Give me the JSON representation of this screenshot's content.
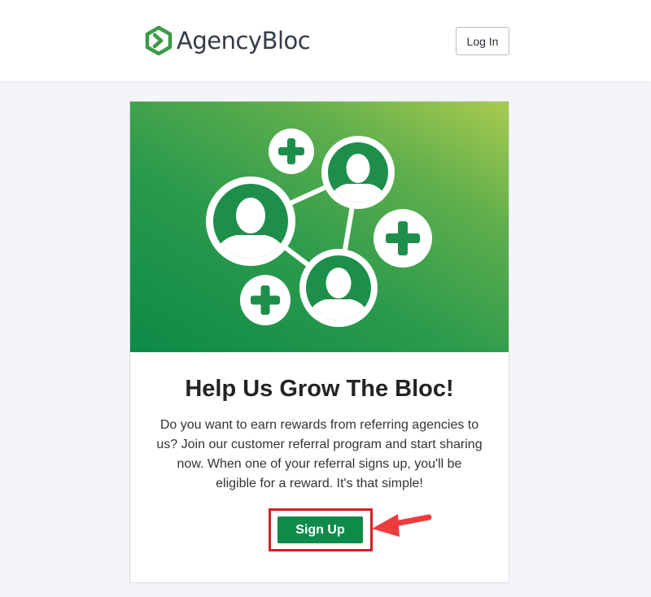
{
  "header": {
    "brand_name": "AgencyBloc",
    "login_label": "Log In"
  },
  "promo": {
    "title": "Help Us Grow The Bloc!",
    "body": "Do you want to earn rewards from referring agencies to us? Join our customer referral program and start sharing now. When one of your referral signs up, you'll be eligible for a reward. It's that simple!",
    "signup_label": "Sign Up"
  },
  "icons": {
    "logo": "agencybloc-hexagon-icon",
    "hero": "referral-network-icon",
    "plus": "plus-icon",
    "person": "person-icon",
    "annotation": "red-arrow-icon"
  },
  "colors": {
    "brand_green": "#0e8a49",
    "logo_green": "#3a9b46",
    "highlight_red": "#d51f26",
    "page_bg": "#f4f5f8"
  }
}
